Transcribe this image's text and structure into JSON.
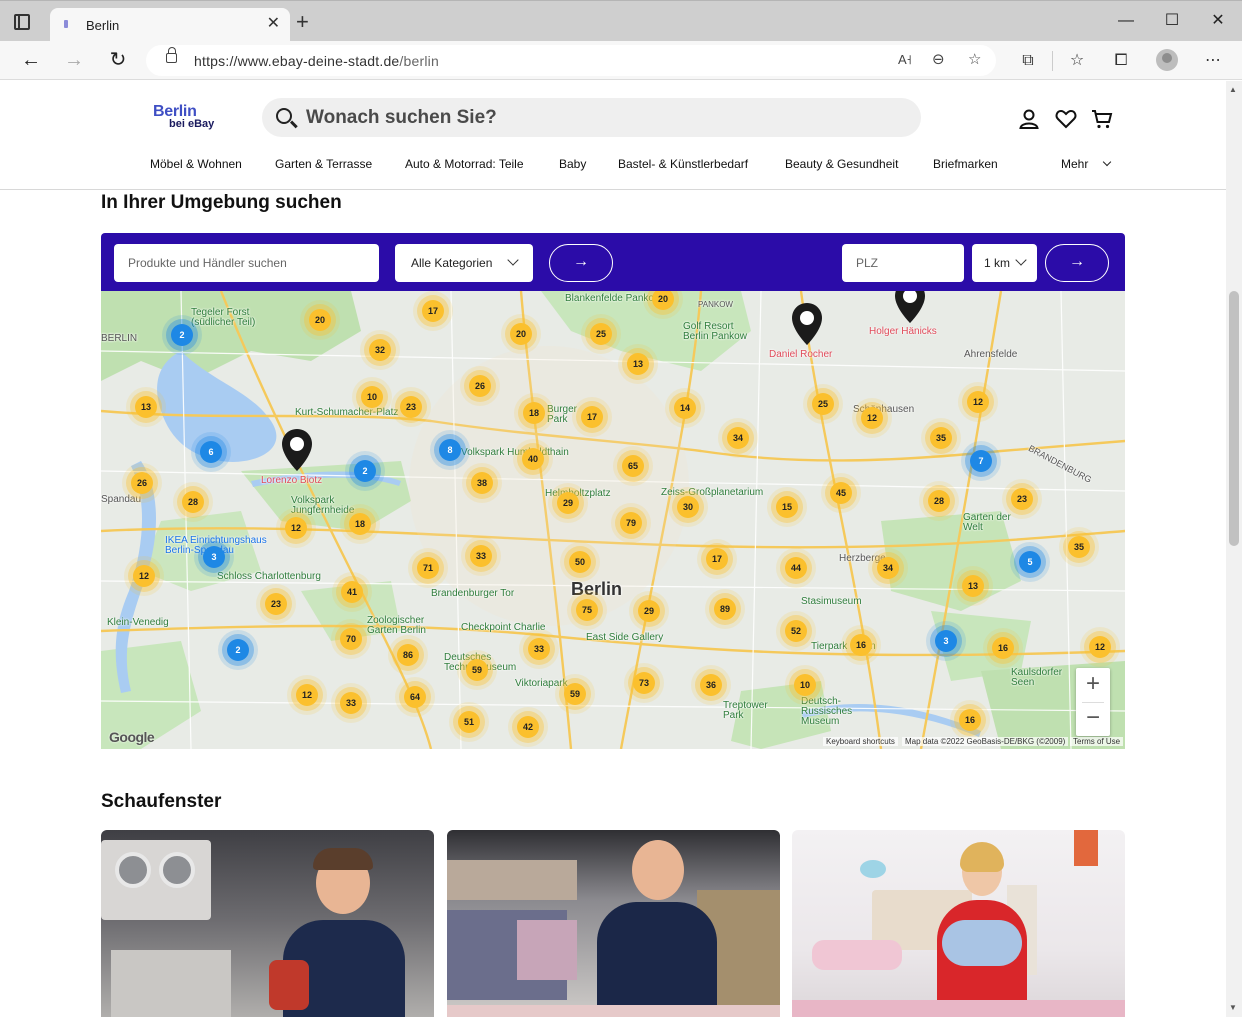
{
  "browser": {
    "tab_title": "Berlin",
    "url_host": "https://www.ebay-deine-stadt.de",
    "url_path": "/berlin"
  },
  "header": {
    "logo_city": "Berlin",
    "logo_sub": "bei eBay",
    "search_placeholder": "Wonach suchen Sie?"
  },
  "categories": [
    "Möbel & Wohnen",
    "Garten & Terrasse",
    "Auto & Motorrad: Teile",
    "Baby",
    "Bastel- & Künstlerbedarf",
    "Beauty & Gesundheit",
    "Briefmarken",
    "Mehr"
  ],
  "nearby": {
    "title": "In Ihrer Umgebung suchen",
    "search_placeholder": "Produkte und Händler suchen",
    "category_value": "Alle Kategorien",
    "plz_placeholder": "PLZ",
    "radius_value": "1 km"
  },
  "map": {
    "city_label": "Berlin",
    "labels": [
      "Tegeler Forst (südlicher Teil)",
      "BERLIN",
      "Blankenfelde Pankow",
      "PANKOW",
      "Golf Resort Berlin Pankow",
      "Ahrensfelde",
      "Kurt-Schumacher-Platz",
      "Volkspark Jungfernheide",
      "Zeiss-Großplanetarium",
      "Helmholtzplatz",
      "IKEA Einrichtungshaus Berlin-Spandau",
      "Schloss Charlottenburg",
      "Brandenburger Tor",
      "Checkpoint Charlie",
      "East Side Gallery",
      "Stasimuseum",
      "Zoologischer Garten Berlin",
      "Deutsches Technikmuseum",
      "Viktoriapark",
      "Treptower Park",
      "Deutsch-Russisches Museum",
      "Kaulsdorfer Seen",
      "Garten der Welt",
      "Herzberge",
      "Tierpark Berlin",
      "Klein-Venedig",
      "Spandau",
      "BRANDENBURG",
      "Schönhausen",
      "Volkspark Humboldthain",
      "Burger Park"
    ],
    "pins": [
      "Daniel Rocher",
      "Holger Hänicks",
      "Lorenzo Biotz"
    ],
    "clusters_yellow": [
      "20",
      "17",
      "20",
      "25",
      "20",
      "32",
      "13",
      "26",
      "10",
      "23",
      "13",
      "14",
      "18",
      "17",
      "34",
      "12",
      "35",
      "25",
      "12",
      "40",
      "65",
      "26",
      "28",
      "38",
      "29",
      "45",
      "28",
      "23",
      "18",
      "12",
      "79",
      "30",
      "15",
      "33",
      "50",
      "17",
      "71",
      "44",
      "34",
      "13",
      "35",
      "12",
      "41",
      "23",
      "75",
      "29",
      "89",
      "52",
      "16",
      "16",
      "12",
      "70",
      "86",
      "33",
      "59",
      "73",
      "36",
      "10",
      "12",
      "33",
      "64",
      "59",
      "51",
      "42",
      "16"
    ],
    "clusters_blue": [
      "2",
      "6",
      "2",
      "8",
      "7",
      "5",
      "3",
      "2",
      "3"
    ],
    "zoom_in": "+",
    "zoom_out": "−",
    "google": "Google",
    "keyboard": "Keyboard shortcuts",
    "mapdata": "Map data ©2022 GeoBasis-DE/BKG (©2009)",
    "terms": "Terms of Use"
  },
  "showcase": {
    "title": "Schaufenster"
  },
  "colors": {
    "filter_bar": "#2b0ca8",
    "cluster_yellow": "#fbc02d",
    "cluster_blue": "#1e88e5"
  }
}
